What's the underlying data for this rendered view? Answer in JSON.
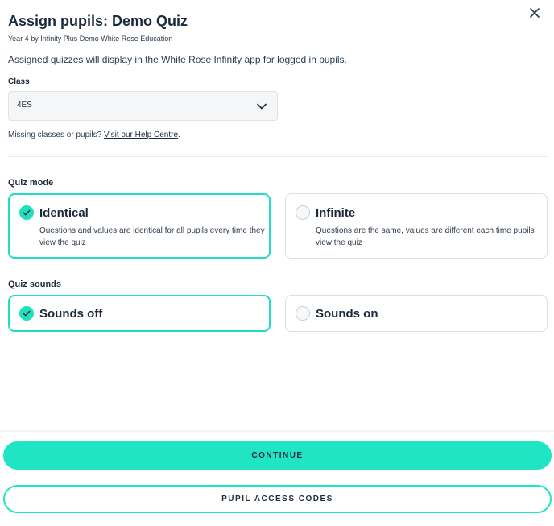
{
  "header": {
    "title": "Assign pupils: Demo Quiz",
    "subtitle": "Year 4 by Infinity Plus Demo White Rose Education",
    "close_icon": "close-icon"
  },
  "info_text": "Assigned quizzes will display in the White Rose Infinity app for logged in pupils.",
  "class_field": {
    "label": "Class",
    "value": "4ES",
    "icon": "chevron-down-icon"
  },
  "help": {
    "prefix": "Missing classes or pupils? ",
    "link": "Visit our Help Centre",
    "suffix": "."
  },
  "quiz_mode": {
    "label": "Quiz mode",
    "options": [
      {
        "title": "Identical",
        "description": "Questions and values are identical for all pupils every time they view the quiz",
        "selected": true
      },
      {
        "title": "Infinite",
        "description": "Questions are the same, values are different each time pupils view the quiz",
        "selected": false
      }
    ]
  },
  "quiz_sounds": {
    "label": "Quiz sounds",
    "options": [
      {
        "title": "Sounds off",
        "selected": true
      },
      {
        "title": "Sounds on",
        "selected": false
      }
    ]
  },
  "buttons": {
    "continue": "CONTINUE",
    "pupil_access_codes": "PUPIL ACCESS CODES"
  },
  "colors": {
    "accent": "#1fe5c4",
    "text": "#1f2d3d"
  }
}
